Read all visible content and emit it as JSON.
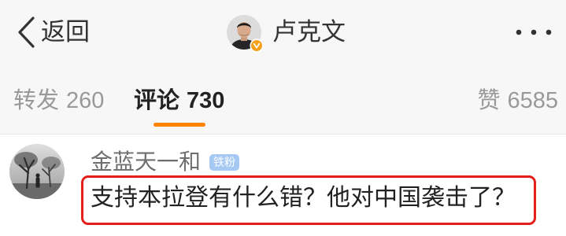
{
  "nav": {
    "back_label": "返回",
    "title": "卢克文",
    "back_icon": "chevron-left-icon",
    "more_icon": "more-horizontal-icon",
    "verified_icon": "verified-badge-icon"
  },
  "tabs": [
    {
      "label": "转发",
      "count": 260,
      "active": false
    },
    {
      "label": "评论",
      "count": 730,
      "active": true
    },
    {
      "label": "赞",
      "count": 6585,
      "active": false
    }
  ],
  "comment": {
    "username": "金蓝天一和",
    "badge": "铁粉",
    "text": "支持本拉登有什么错？他对中国袭击了？"
  },
  "colors": {
    "accent": "#ff8200",
    "highlight": "#e5201b",
    "fan_badge": "#a6c9f3",
    "verified": "#f6a019"
  }
}
